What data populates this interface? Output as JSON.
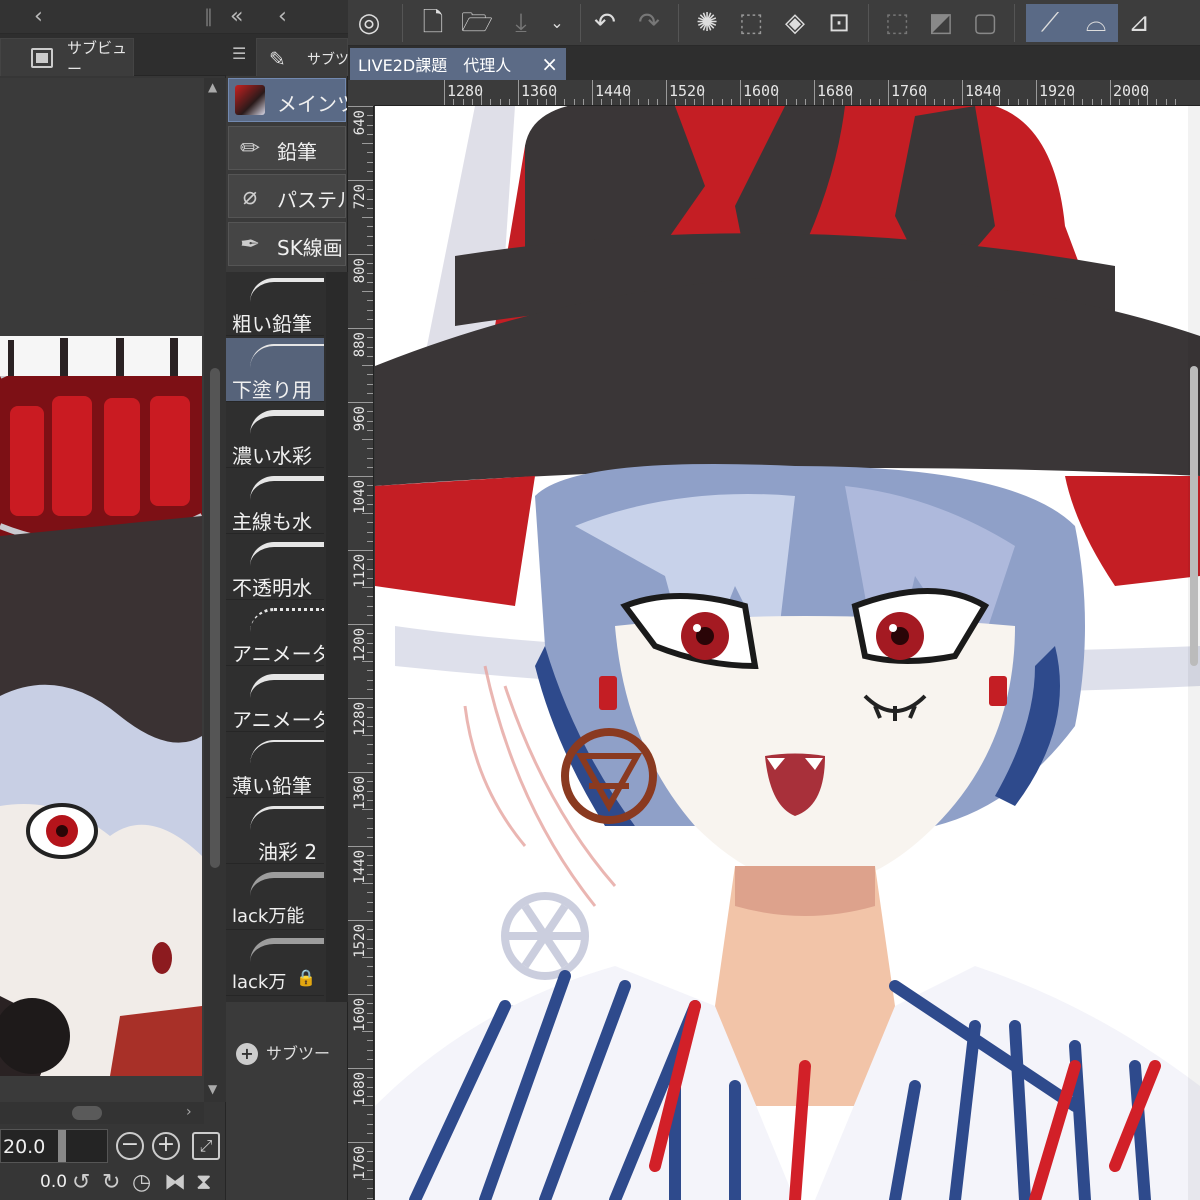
{
  "subview": {
    "tab_label": "サブビュー",
    "zoom_value": "20.0",
    "rotation_value": "0.0"
  },
  "brush_panel": {
    "tab_label": "サブツ",
    "tools": [
      {
        "label": "メインツー",
        "icon": "avatar-icon",
        "active": true
      },
      {
        "label": "鉛筆",
        "icon": "pencil-icon",
        "active": false
      },
      {
        "label": "パステル",
        "icon": "pastel-icon",
        "active": false
      },
      {
        "label": "SK線画",
        "icon": "pen-nib-icon",
        "active": false
      }
    ],
    "brushes": [
      {
        "label": "粗い鉛筆",
        "active": false
      },
      {
        "label": "下塗り用",
        "active": true
      },
      {
        "label": "濃い水彩",
        "active": false
      },
      {
        "label": "主線も水",
        "active": false
      },
      {
        "label": "不透明水",
        "active": false
      },
      {
        "label": "アニメータ",
        "active": false
      },
      {
        "label": "アニメータ",
        "active": false
      },
      {
        "label": "薄い鉛筆",
        "active": false
      },
      {
        "label": "油彩 2",
        "active": false
      },
      {
        "label": "lack万能",
        "active": false
      },
      {
        "label": "lack万",
        "active": false
      }
    ],
    "add_sub_tool": "サブツー"
  },
  "document": {
    "tab_title": "LIVE2D課題　代理人"
  },
  "rulers": {
    "horizontal": [
      "1280",
      "1360",
      "1440",
      "1520",
      "1600",
      "1680",
      "1760",
      "1840",
      "1920",
      "2000"
    ],
    "vertical": [
      "640",
      "720",
      "800",
      "880",
      "960",
      "1040",
      "1120",
      "1200",
      "1280",
      "1360",
      "1440",
      "1520",
      "1600",
      "1680",
      "1760"
    ]
  },
  "colors": {
    "accent": "#5c6b86",
    "hat_black": "#3a3637",
    "hat_red": "#c41e24",
    "hair_blue": "#8fa0c8",
    "stripe_blue": "#2e4a8c"
  }
}
